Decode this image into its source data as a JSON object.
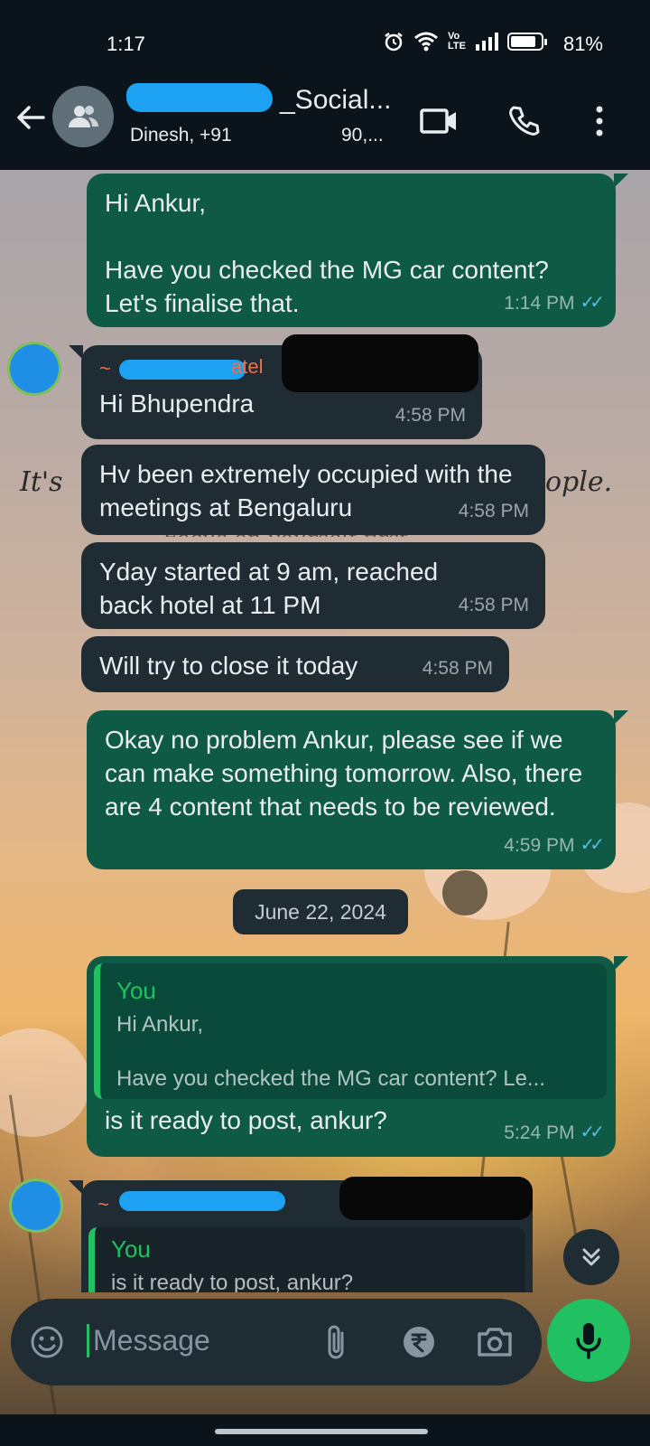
{
  "status_bar": {
    "time": "1:17",
    "battery": "81%",
    "icons": [
      "alarm-icon",
      "wifi-icon",
      "volte-icon",
      "signal-icon",
      "battery-icon"
    ]
  },
  "header": {
    "title": "_Social...",
    "subtitle": "Dinesh, +91 ",
    "subtitle_tail": "90,..."
  },
  "messages": [
    {
      "id": "m1",
      "direction": "out",
      "text": "Hi Ankur,\n\nHave you checked the MG car content? Let's finalise that.",
      "time": "1:14 PM",
      "status": "read"
    },
    {
      "id": "m2",
      "direction": "in",
      "sender": "~ ... Patel",
      "text": "Hi Bhupendra",
      "time": "4:58 PM"
    },
    {
      "id": "m3",
      "direction": "in",
      "text": "Hv been extremely occupied with the meetings at Bengaluru",
      "time": "4:58 PM"
    },
    {
      "id": "m4",
      "direction": "in",
      "text": "Yday started at 9 am, reached back hotel at 11 PM",
      "time": "4:58 PM"
    },
    {
      "id": "m5",
      "direction": "in",
      "text": "Will try to close it today",
      "time": "4:58 PM"
    },
    {
      "id": "m6",
      "direction": "out",
      "text": "Okay no problem Ankur, please see if we can make something tomorrow. Also, there are 4 content that needs to be reviewed.",
      "time": "4:59 PM",
      "status": "read"
    },
    {
      "id": "m7",
      "direction": "out",
      "quote": {
        "author": "You",
        "line1": "Hi Ankur,",
        "line2": "Have you checked the MG car content? Le..."
      },
      "text": "is it ready to post, ankur?",
      "time": "5:24 PM",
      "status": "read"
    },
    {
      "id": "m8",
      "direction": "in",
      "sender": "~ ...",
      "quote": {
        "author": "You",
        "line1": "is it ready to post, ankur?"
      }
    }
  ],
  "date_divider": "June 22, 2024",
  "wallpaper": {
    "text_left": "It's",
    "text_right": "ople.",
    "text_middle": "Focus on yourself first"
  },
  "composer": {
    "placeholder": "Message",
    "icons": [
      "emoji-icon",
      "attach-icon",
      "rupee-icon",
      "camera-icon",
      "mic-icon"
    ]
  },
  "colors": {
    "outgoing_bubble": "#0f5a45",
    "incoming_bubble": "#202c33",
    "accent_green": "#21c063",
    "read_ticks": "#53bdeb"
  }
}
